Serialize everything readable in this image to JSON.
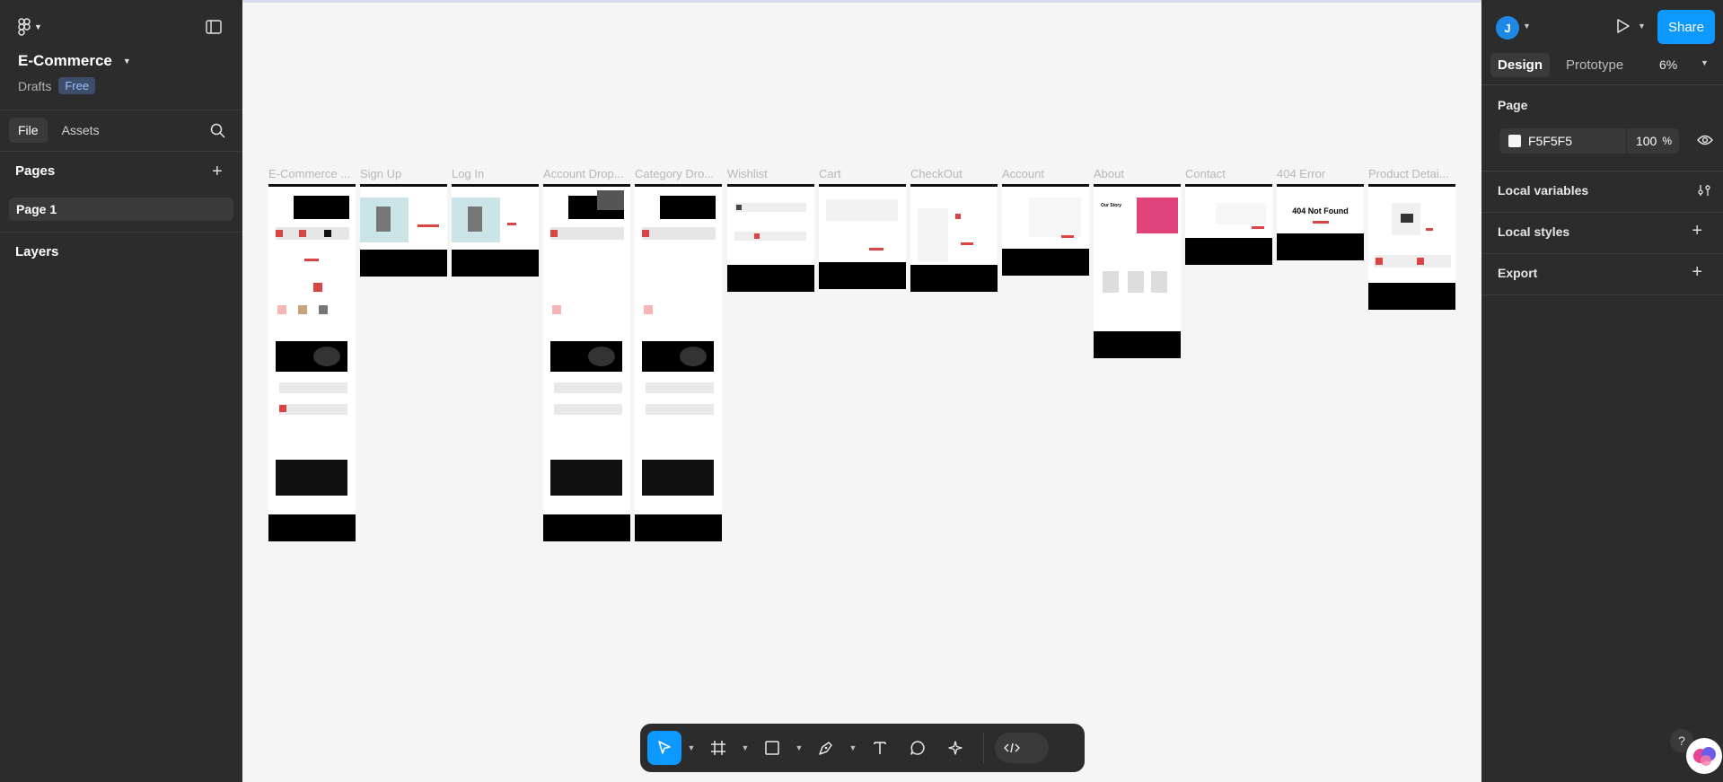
{
  "file": {
    "title": "E-Commerce",
    "location": "Drafts",
    "plan_badge": "Free"
  },
  "left_tabs": [
    {
      "label": "File"
    },
    {
      "label": "Assets"
    }
  ],
  "pages_section": {
    "title": "Pages",
    "items": [
      {
        "label": "Page 1"
      }
    ]
  },
  "layers_section": {
    "title": "Layers"
  },
  "frames": [
    {
      "label": "E-Commerce ..."
    },
    {
      "label": "Sign Up"
    },
    {
      "label": "Log In"
    },
    {
      "label": "Account Drop..."
    },
    {
      "label": "Category Dro..."
    },
    {
      "label": "Wishlist"
    },
    {
      "label": "Cart"
    },
    {
      "label": "CheckOut"
    },
    {
      "label": "Account"
    },
    {
      "label": "About"
    },
    {
      "label": "Contact"
    },
    {
      "label": "404 Error"
    },
    {
      "label": "Product Detai..."
    }
  ],
  "frame_texts": {
    "about_story": "Our Story",
    "not_found": "404 Not Found"
  },
  "right_panel": {
    "user_initial": "J",
    "share_label": "Share",
    "tabs": [
      {
        "label": "Design"
      },
      {
        "label": "Prototype"
      }
    ],
    "zoom": "6%",
    "page_heading": "Page",
    "bg_color": "F5F5F5",
    "bg_opacity": "100",
    "opacity_unit": "%",
    "local_variables": "Local variables",
    "local_styles": "Local styles",
    "export": "Export"
  },
  "help_label": "?",
  "colors": {
    "accent": "#0d99ff",
    "panel": "#2c2c2c",
    "canvas": "#f5f5f5",
    "brand_red": "#db4444"
  }
}
